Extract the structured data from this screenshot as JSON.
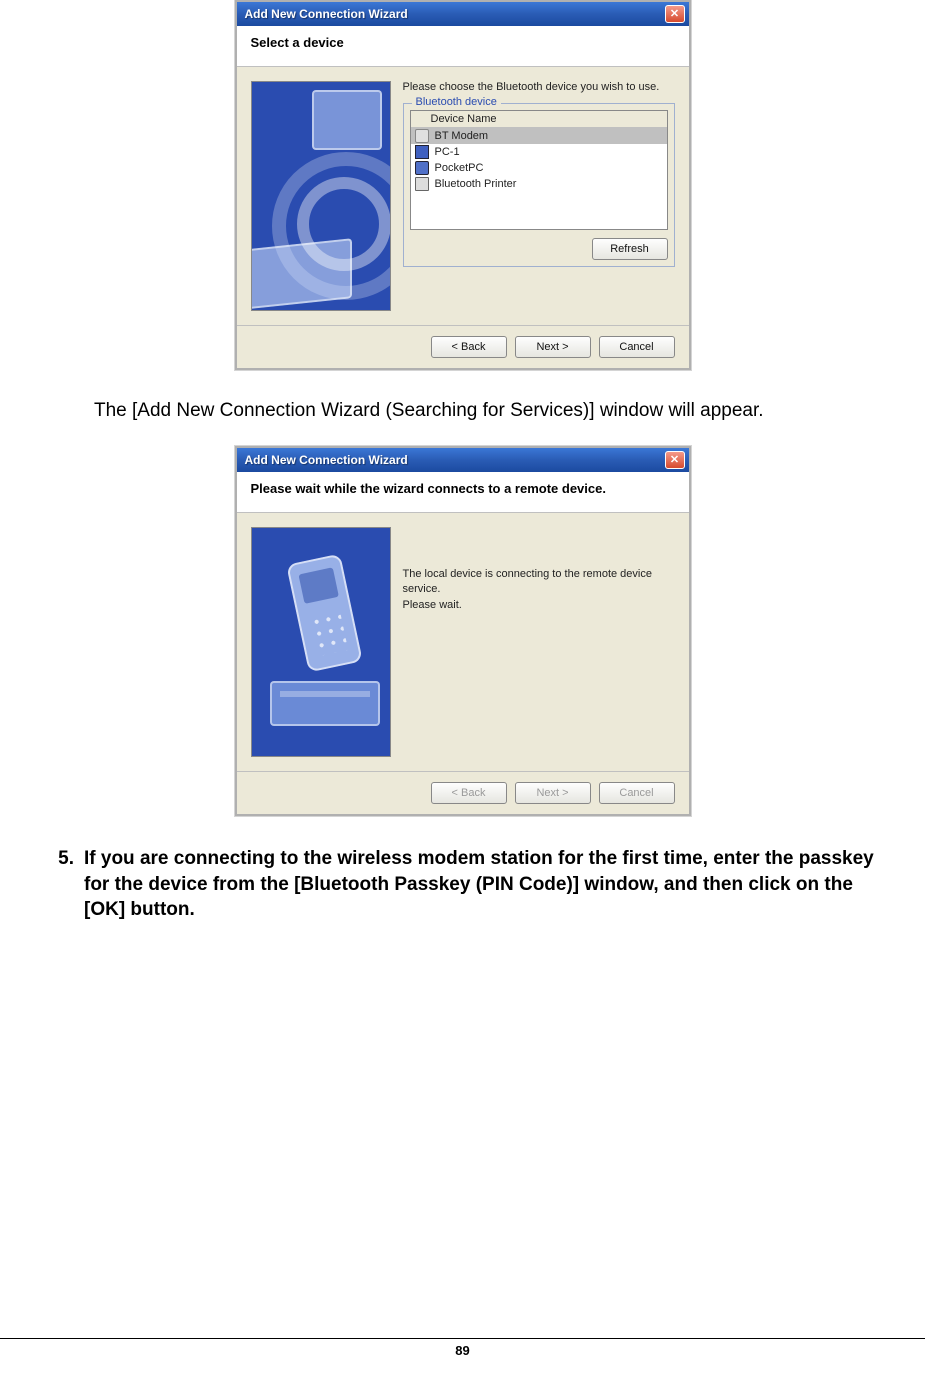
{
  "wizard1": {
    "title": "Add New Connection Wizard",
    "header": "Select a device",
    "instruction": "Please choose the Bluetooth device you wish to use.",
    "groupbox_label": "Bluetooth device",
    "column_header": "Device Name",
    "devices": [
      {
        "label": "BT Modem"
      },
      {
        "label": "PC-1"
      },
      {
        "label": "PocketPC"
      },
      {
        "label": "Bluetooth Printer"
      }
    ],
    "refresh": "Refresh",
    "back": "< Back",
    "next": "Next >",
    "cancel": "Cancel"
  },
  "caption1": "The [Add New Connection Wizard (Searching for Services)] window will appear.",
  "wizard2": {
    "title": "Add New Connection Wizard",
    "header": "Please wait while the wizard connects to a remote device.",
    "msg_line1": "The local device is connecting to the remote device service.",
    "msg_line2": "Please wait.",
    "back": "< Back",
    "next": "Next >",
    "cancel": "Cancel"
  },
  "step5": {
    "num": "5.",
    "text": "If you are connecting to the wireless modem station for the first time, enter the passkey for the device from the [Bluetooth Passkey (PIN Code)] window, and then click on the [OK] button."
  },
  "page_number": "89"
}
